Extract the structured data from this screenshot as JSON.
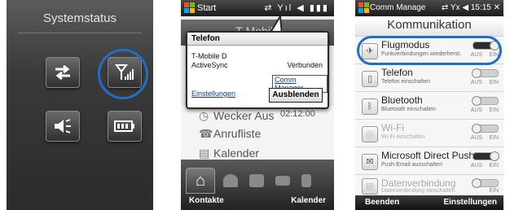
{
  "systemstatus": {
    "title": "Systemstatus",
    "tiles": [
      {
        "icon": "sync-arrows-icon"
      },
      {
        "icon": "signal-antenna-icon"
      },
      {
        "icon": "speaker-icon"
      },
      {
        "icon": "battery-icon"
      }
    ]
  },
  "start_screen": {
    "topbar_title": "Start",
    "status_icons": "⇄ Yıl ◀ ▮▮▮",
    "operator": "T-Mobile",
    "popup": {
      "title": "Telefon",
      "line1": "T-Mobile D",
      "line2": "ActiveSync",
      "status": "Verbunden",
      "comm_manager": "Comm Manager",
      "settings": "Einstellungen",
      "hide": "Ausblenden"
    },
    "list": [
      {
        "icon": "clock-icon",
        "label": "Wecker Aus",
        "value": "02:12:00"
      },
      {
        "icon": "phone-icon",
        "label": "Anrufliste"
      },
      {
        "icon": "calendar-icon",
        "label": "Kalender"
      }
    ],
    "bottom_left": "Kontakte",
    "bottom_right": "Kalender"
  },
  "communication": {
    "topbar_title": "Comm Manage",
    "topbar_status": "⇄ Yx ◀ 15:15 ✕",
    "heading": "Kommunikation",
    "off_label": "AUS",
    "on_label": "EIN",
    "items": [
      {
        "name": "Flugmodus",
        "desc": "Funkverbindungen wiederherst.",
        "state": "on",
        "dim": false
      },
      {
        "name": "Telefon",
        "desc": "Telefon einschalten",
        "state": "off",
        "dim": false
      },
      {
        "name": "Bluetooth",
        "desc": "Bluetooth einschalten",
        "state": "off",
        "dim": false
      },
      {
        "name": "Wi-Fi",
        "desc": "Wi-Fi einschalten",
        "state": "off",
        "dim": true
      },
      {
        "name": "Microsoft Direct Push",
        "desc": "Push-Email ausschalten",
        "state": "on",
        "dim": false
      },
      {
        "name": "Datenverbindung",
        "desc": "Datenverbindung einschalten",
        "state": "off",
        "dim": true
      }
    ],
    "bottom_left": "Beenden",
    "bottom_right": "Einstellungen"
  },
  "colors": {
    "highlight": "#1f6fc7"
  }
}
